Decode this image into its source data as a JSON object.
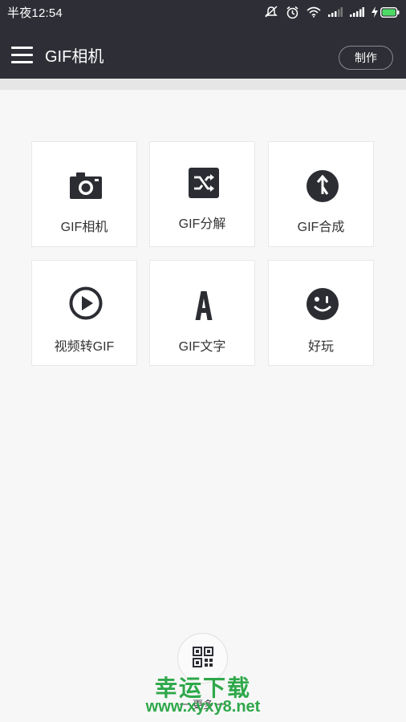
{
  "status_bar": {
    "time": "半夜12:54",
    "icons": [
      "mute-icon",
      "alarm-icon",
      "wifi-icon",
      "signal-icon",
      "signal-icon",
      "charging-icon",
      "battery-icon"
    ],
    "battery_color": "#4cd964"
  },
  "toolbar": {
    "title": "GIF相机",
    "make_label": "制作",
    "background": "#2e2f36"
  },
  "grid": {
    "items": [
      {
        "label": "GIF相机",
        "icon": "camera-icon"
      },
      {
        "label": "GIF分解",
        "icon": "shuffle-icon"
      },
      {
        "label": "GIF合成",
        "icon": "merge-icon"
      },
      {
        "label": "视频转GIF",
        "icon": "play-icon"
      },
      {
        "label": "GIF文字",
        "icon": "letter-a-icon"
      },
      {
        "label": "好玩",
        "icon": "smiley-icon"
      }
    ]
  },
  "bottom": {
    "more_label": "一 更多 一",
    "icon": "qr-code-icon"
  },
  "watermark": {
    "title": "幸运下载",
    "url": "www.xyxy8.net",
    "color": "#2ea84a"
  }
}
